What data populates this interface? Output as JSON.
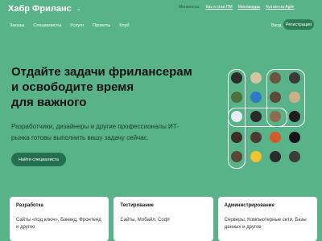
{
  "brand": {
    "name": "Хабр Фриланс"
  },
  "top_links": {
    "label": "Мегапосты:",
    "items": [
      "Как я стал ПМ",
      "Миллиарды",
      "Кухтия на Agile"
    ]
  },
  "nav": {
    "items": [
      "Заказы",
      "Специалисты",
      "Услуги",
      "Проекты",
      "Клуб"
    ],
    "login": "Вход",
    "signup": "Регистрация"
  },
  "hero": {
    "title_line1": "Отдайте задачи фрилансерам",
    "title_line2": "и освободите время",
    "title_line3": "для важного",
    "subtitle_line1": "Разработчики, дизайнеры и другие профессионалы ИТ-",
    "subtitle_line2": "рынка готовы выполнить вашу задачу сейчас.",
    "cta": "Найти специалиста"
  },
  "avatars": {
    "colors": [
      "#2c2c2c",
      "#d6c4a0",
      "#6b5540",
      "#3a3a3a",
      "#4e6f3f",
      "#2f7ac7",
      "#5b4a3a",
      "#c9b089",
      "#e7eef5",
      "#2a2a2a",
      "#8c6b4f",
      "#1e1e1e",
      "#3b2e26",
      "#4a3a30",
      "#d45a2a",
      "#161616",
      "#5a4636",
      "#f2c230",
      "#2b2b2b",
      "#3c3c3c"
    ]
  },
  "cards": [
    {
      "title": "Разработка",
      "text": "Сайты «под ключ», Бэкенд, Фронтенд и другое"
    },
    {
      "title": "Тестирование",
      "text": "Сайты, Мобайл, Софт"
    },
    {
      "title": "Администрирование",
      "text": "Серверы, Компьютерные сети, Базы данных и другое"
    }
  ]
}
